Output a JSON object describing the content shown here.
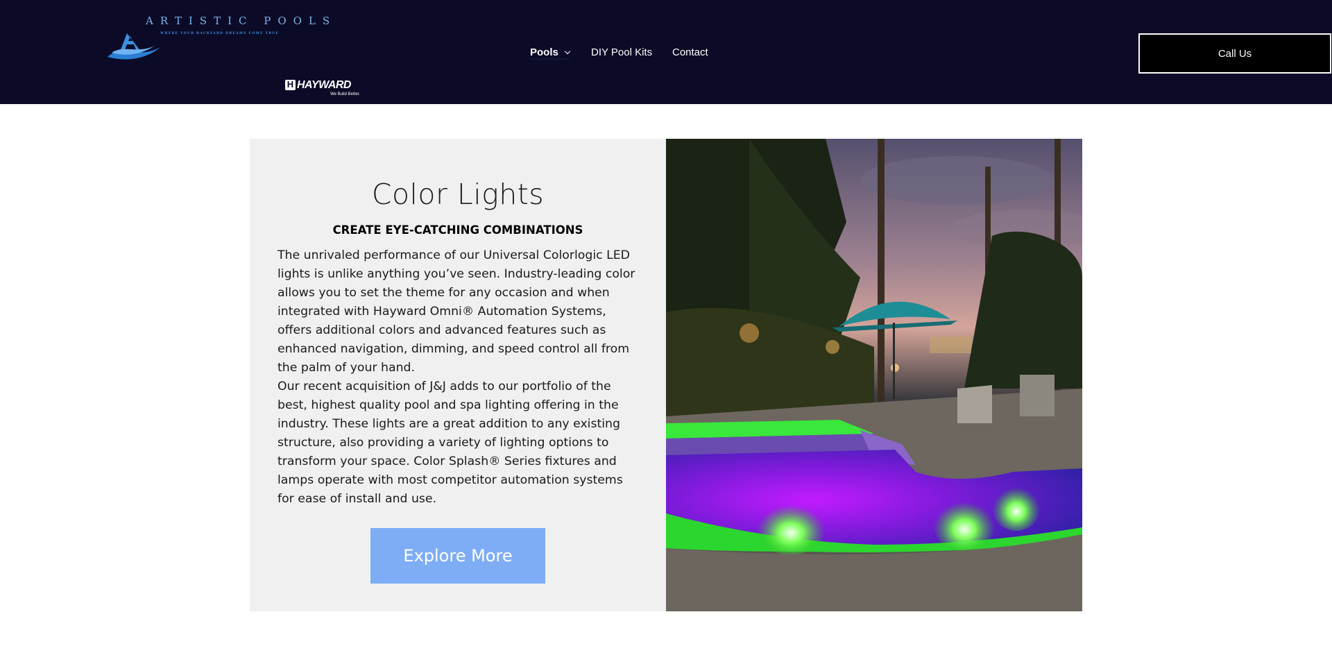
{
  "brand": {
    "name": "ARTISTIC POOLS",
    "tagline": "WHERE YOUR BACKYARD DREAMS COME TRUE",
    "logo_icon": "wave-a-icon"
  },
  "partner": {
    "name": "HAYWARD",
    "slogan": "We Build Better.",
    "icon": "hayward-h-icon"
  },
  "nav": {
    "items": [
      {
        "label": "Pools",
        "has_dropdown": true
      },
      {
        "label": "DIY Pool Kits"
      },
      {
        "label": "Contact"
      }
    ]
  },
  "header": {
    "call_label": "Call Us"
  },
  "feature": {
    "title": "Color Lights",
    "subtitle": "CREATE EYE-CATCHING COMBINATIONS",
    "paragraph1": "The unrivaled performance of our Universal Colorlogic LED lights is unlike anything you’ve seen. Industry-leading color allows you to set the theme for any occasion and when integrated with Hayward Omni® Automation Systems, offers additional colors and advanced features such as enhanced navigation, dimming, and speed control all from the palm of your hand.",
    "paragraph2": "Our recent acquisition of J&J adds to our portfolio of the best, highest quality pool and spa lighting offering in the industry. These lights are a great addition to any existing structure, also providing a variety of lighting options to transform your space. Color Splash® Series fixtures and lamps operate with most competitor automation systems for ease of install and use.",
    "button_label": "Explore More"
  },
  "colors": {
    "header_bg": "#0b0b27",
    "panel_bg": "#f0f0f0",
    "button_bg": "#7fadf5",
    "logo_blue": "#3b8fe0"
  }
}
